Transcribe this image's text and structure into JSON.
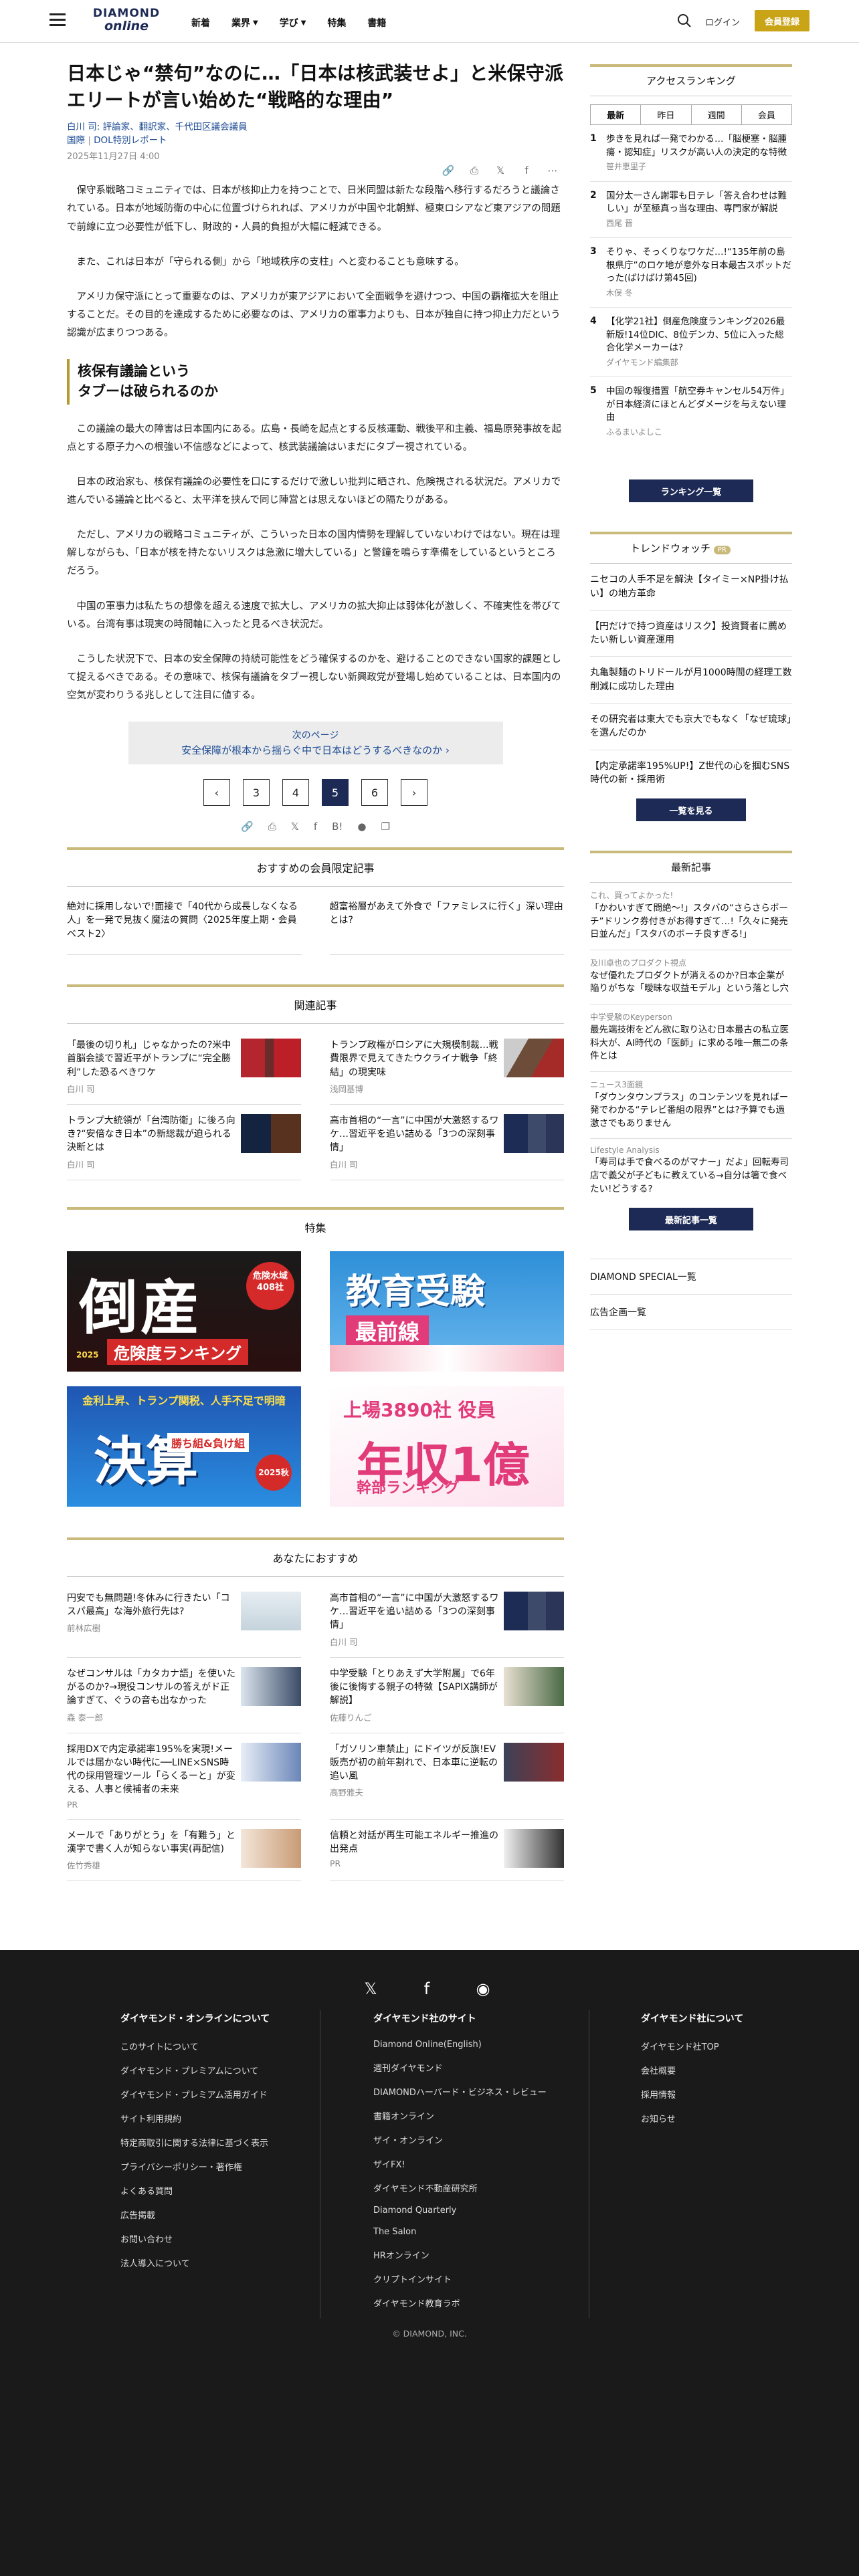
{
  "header": {
    "logo_line1": "DIAMOND",
    "logo_line2": "online",
    "nav": [
      "新着",
      "業界",
      "学び",
      "特集",
      "書籍"
    ],
    "login": "ログイン",
    "member": "会員登録"
  },
  "article": {
    "title": "日本じゃ“禁句”なのに…「日本は核武装せよ」と米保守派エリートが言い始めた“戦略的な理由”",
    "author": "白川 司: 評論家、翻訳家、千代田区議会議員",
    "series_category": "国際",
    "series_name": "DOL特別レポート",
    "date": "2025年11月27日 4:00",
    "paragraphs_a": [
      "保守系戦略コミュニティでは、日本が核抑止力を持つことで、日米同盟は新たな段階へ移行するだろうと議論されている。日本が地域防衛の中心に位置づけられれば、アメリカが中国や北朝鮮、極東ロシアなど東アジアの問題で前線に立つ必要性が低下し、財政的・人員的負担が大幅に軽減できる。",
      "また、これは日本が「守られる側」から「地域秩序の支柱」へと変わることも意味する。",
      "アメリカ保守派にとって重要なのは、アメリカが東アジアにおいて全面戦争を避けつつ、中国の覇権拡大を阻止することだ。その目的を達成するために必要なのは、アメリカの軍事力よりも、日本が独自に持つ抑止力だという認識が広まりつつある。"
    ],
    "h2": "核保有議論という\nタブーは破られるのか",
    "paragraphs_b": [
      "この議論の最大の障害は日本国内にある。広島・長崎を起点とする反核運動、戦後平和主義、福島原発事故を起点とする原子力への根強い不信感などによって、核武装議論はいまだにタブー視されている。",
      "日本の政治家も、核保有議論の必要性を口にするだけで激しい批判に晒され、危険視される状況だ。アメリカで進んでいる議論と比べると、太平洋を挟んで同じ陣営とは思えないほどの隔たりがある。",
      "ただし、アメリカの戦略コミュニティが、こういった日本の国内情勢を理解していないわけではない。現在は理解しながらも、「日本が核を持たないリスクは急激に増大している」と警鐘を鳴らす準備をしているというところだろう。",
      "中国の軍事力は私たちの想像を超える速度で拡大し、アメリカの拡大抑止は弱体化が激しく、不確実性を帯びている。台湾有事は現実の時間軸に入ったと見るべき状況だ。",
      "こうした状況下で、日本の安全保障の持続可能性をどう確保するのかを、避けることのできない国家的課題として捉えるべきである。その意味で、核保有議論をタブー視しない新興政党が登場し始めていることは、日本国内の空気が変わりうる兆しとして注目に値する。"
    ],
    "next_label": "次のページ",
    "next_title": "安全保障が根本から揺らぐ中で日本はどうするべきなのか",
    "pages": [
      "3",
      "4",
      "5",
      "6"
    ],
    "current_page": "5"
  },
  "member_section": {
    "title": "おすすめの会員限定記事",
    "items": [
      "絶対に採用しないで!面接で「40代から成長しなくなる人」を一発で見抜く魔法の質問〈2025年度上期・会員ベスト2〉",
      "超富裕層があえて外食で「ファミレスに行く」深い理由とは?"
    ]
  },
  "related": {
    "title": "関連記事",
    "items": [
      {
        "title": "「最後の切り札」じゃなかったの?米中首脳会談で習近平がトランプに“完全勝利”した恐るべきワケ",
        "author": "白川 司"
      },
      {
        "title": "トランプ政権がロシアに大規模制裁…戦費限界で見えてきたウクライナ戦争「終結」の現実味",
        "author": "浅岡基博"
      },
      {
        "title": "高市首相の“一言”に中国が大激怒するワケ…習近平を追い詰める「3つの深刻事情」",
        "author": "白川 司"
      },
      {
        "title": "トランプ大統領が「台湾防衛」に後ろ向き?“安倍なき日本”の新総裁が迫られる決断とは",
        "author": "白川 司"
      }
    ]
  },
  "feature": {
    "title": "特集",
    "items": [
      {
        "main": "倒産",
        "sub": "危険度ランキング",
        "badge": "危険水域 408社",
        "year": "2025"
      },
      {
        "main": "教育受験",
        "sub": "最前線"
      },
      {
        "main": "決算",
        "sub": "勝ち組&負け組",
        "top": "金利上昇、トランプ関税、人手不足で明暗",
        "year": "2025秋"
      },
      {
        "main": "年収1億",
        "sub": "幹部ランキング",
        "top": "上場3890社 役員"
      }
    ]
  },
  "recommend": {
    "title": "あなたにおすすめ",
    "items": [
      {
        "title": "円安でも無問題!冬休みに行きたい「コスパ最高」な海外旅行先は?",
        "author": "前林広樹"
      },
      {
        "title": "高市首相の“一言”に中国が大激怒するワケ…習近平を追い詰める「3つの深刻事情」",
        "author": "白川 司"
      },
      {
        "title": "なぜコンサルは「カタカナ語」を使いたがるのか?→現役コンサルの答えがド正論すぎて、ぐうの音も出なかった",
        "author": "森 泰一郎"
      },
      {
        "title": "中学受験「とりあえず大学附属」で6年後に後悔する親子の特徴【SAPIX講師が解説】",
        "author": "佐藤りんご"
      },
      {
        "title": "採用DXで内定承諾率195%を実現!メールでは届かない時代に──LINE×SNS時代の採用管理ツール「らくるーと」が変える、人事と候補者の未来",
        "author": "PR"
      },
      {
        "title": "「ガソリン車禁止」にドイツが反旗!EV販売が初の前年割れで、日本車に逆転の追い風",
        "author": "高野雅夫"
      },
      {
        "title": "メールで「ありがとう」を「有難う」と漢字で書く人が知らない事実(再配信)",
        "author": "佐竹秀雄"
      },
      {
        "title": "信頼と対話が再生可能エネルギー推進の出発点",
        "author": "PR"
      }
    ]
  },
  "sidebar": {
    "ranking_title": "アクセスランキング",
    "tabs": [
      "最新",
      "昨日",
      "週間",
      "会員"
    ],
    "ranking": [
      {
        "title": "歩きを見れば一発でわかる…「脳梗塞・脳腫瘍・認知症」リスクが高い人の決定的な特徴",
        "author": "笹井恵里子"
      },
      {
        "title": "国分太一さん謝罪も日テレ「答え合わせは難しい」が至極真っ当な理由、専門家が解説",
        "author": "西尾 晋"
      },
      {
        "title": "そりゃ、そっくりなワケだ…!“135年前の島根県庁”のロケ地が意外な日本最古スポットだった(ばけばけ第45回)",
        "author": "木俣 冬"
      },
      {
        "title": "【化学21社】倒産危険度ランキング2026最新版!14位DIC、8位デンカ、5位に入った総合化学メーカーは?",
        "author": "ダイヤモンド編集部"
      },
      {
        "title": "中国の報復措置「航空券キャンセル54万件」が日本経済にほとんどダメージを与えない理由",
        "author": "ふるまいよしこ"
      }
    ],
    "ranking_btn": "ランキング一覧",
    "trend_title": "トレンドウォッチ",
    "trend_badge": "PR",
    "trends": [
      "ニセコの人手不足を解決【タイミー×NP掛け払い】の地方革命",
      "【円だけで持つ資産はリスク】投資賢者に薦めたい新しい資産運用",
      "丸亀製麺のトリドールが月1000時間の経理工数削減に成功した理由",
      "その研究者は東大でも京大でもなく「なぜ琉球」を選んだのか",
      "【内定承諾率195%UP!】Z世代の心を掴むSNS時代の新・採用術"
    ],
    "trend_btn": "一覧を見る",
    "latest_title": "最新記事",
    "latest": [
      {
        "cat": "これ、買ってよかった!",
        "title": "「かわいすぎて問絶〜!」スタバの“さらさらボーチ”ドリンク券付きがお得すぎて…!「久々に発売日並んだ」「スタバのボーチ良すぎる!」"
      },
      {
        "cat": "及川卓也のプロダクト視点",
        "title": "なぜ優れたプロダクトが消えるのか?日本企業が陥りがちな「曖昧な収益モデル」という落とし穴"
      },
      {
        "cat": "中学受験のKeyperson",
        "title": "最先端技術をどん欲に取り込む日本最古の私立医科大が、AI時代の「医師」に求める唯一無二の条件とは"
      },
      {
        "cat": "ニュース3面鏡",
        "title": "「ダウンタウンプラス」のコンテンツを見ればー発でわかる“テレビ番組の限界”とは?予算でも過激さでもありません"
      },
      {
        "cat": "Lifestyle Analysis",
        "title": "「寿司は手で食べるのがマナー」だよ」回転寿司店で義父が子どもに教えている→自分は箸で食べたい!どうする?"
      }
    ],
    "latest_btn": "最新記事一覧",
    "links": [
      "DIAMOND SPECIAL一覧",
      "広告企画一覧"
    ]
  },
  "footer": {
    "col1_title": "ダイヤモンド・オンラインについて",
    "col1": [
      "このサイトについて",
      "ダイヤモンド・プレミアムについて",
      "ダイヤモンド・プレミアム活用ガイド",
      "サイト利用規約",
      "特定商取引に関する法律に基づく表示",
      "プライバシーポリシー・著作権",
      "よくある質問",
      "広告掲載",
      "お問い合わせ",
      "法人導入について"
    ],
    "col2_title": "ダイヤモンド社のサイト",
    "col2": [
      "Diamond Online(English)",
      "週刊ダイヤモンド",
      "DIAMONDハーバード・ビジネス・レビュー",
      "書籍オンライン",
      "ザイ・オンライン",
      "ザイFX!",
      "ダイヤモンド不動産研究所",
      "Diamond Quarterly",
      "The Salon",
      "HRオンライン",
      "クリプトインサイト",
      "ダイヤモンド教育ラボ"
    ],
    "col3_title": "ダイヤモンド社について",
    "col3": [
      "ダイヤモンド社TOP",
      "会社概要",
      "採用情報",
      "お知らせ"
    ],
    "copyright": "© DIAMOND, INC."
  }
}
